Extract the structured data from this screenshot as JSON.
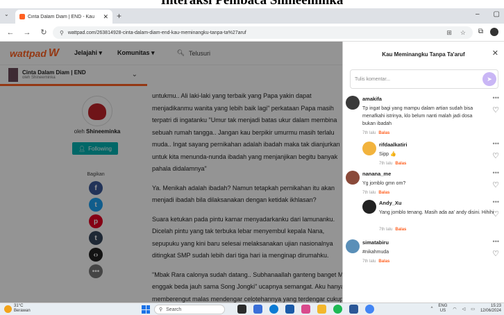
{
  "caption": "Interaksi Pembaca Shineeminka",
  "browser": {
    "tab_title": "Cinta Dalam Diam | END - Kau",
    "url": "wattpad.com/263814928-cinta-dalam-diam-end-kau-meminangku-tanpa-ta%27aruf"
  },
  "wattpad": {
    "logo": "wattpad",
    "nav": [
      "Jelajahi ▾",
      "Komunitas ▾"
    ],
    "search": "Telusuri",
    "story_title": "Cinta Dalam Diam | END",
    "story_author": "oleh Shineeminka",
    "byline_prefix": "oleh",
    "author_name": "Shineeminka",
    "follow_label": "Following",
    "share_label": "Bagikan",
    "paragraphs": [
      [
        "untukmu.. Ali laki-laki yang terbaik yang Papa yakin dapat",
        "menjadikanmu wanita yang lebih baik lagi\" perkataan Papa masih",
        "terpatri di ingatanku \"Umur tak menjadi batas ukur dalam membina",
        "sebuah rumah tangga.. Jangan kau berpikir umurmu masih terlalu",
        "muda.. Ingat sayang pernikahan adalah ibadah maka tak dianjurkan",
        "untuk kita menunda-nunda ibadah yang menjanjikan begitu banyak",
        "pahala didalamnya\""
      ],
      [
        "Ya. Menikah adalah ibadah? Namun tetapkah pernikahan itu akan",
        "menjadi ibadah bila dilaksanakan dengan ketidak ikhlasan?"
      ],
      [
        "Suara ketukan pada pintu kamar menyadarkanku dari lamunanku.",
        "Dicelah pintu yang tak terbuka lebar menyembul kepala Nana,",
        "sepupuku yang kini baru selesai melaksanakan ujian nasionalnya",
        "ditingkat SMP sudah lebih dari tiga hari ia menginap dirumahku."
      ],
      [
        "\"Mbak Rara calonya sudah datang.. Subhanaallah ganteng banget Mbak",
        "enggak beda jauh sama Song Jongki\" ucapnya semangat. Aku hanya",
        "memberengut malas mendengar celotehannya yang terdengar cukup"
      ]
    ]
  },
  "panel": {
    "title": "Kau Meminangku Tanpa Ta'aruf",
    "input_placeholder": "Tulis komentar...",
    "comments": [
      {
        "name": "amakifa",
        "text": "Tp ingat bagi yang mampu dalam artian sudah bisa menafkahi istrinya, klo belum nanti malah jadi dosa bukan ibadah",
        "time": "7th lalu",
        "reply": "Balas",
        "avatar_color": "#3a3a3a"
      },
      {
        "name": "rifdaalkatiri",
        "text": "Sipp 👍",
        "time": "7th lalu",
        "reply": "Balas",
        "avatar_color": "#f2b33d"
      },
      {
        "name": "nanana_me",
        "text": "Yg jomblo gmn om?",
        "time": "7th lalu",
        "reply": "Balas",
        "avatar_color": "#8a4a3a"
      },
      {
        "name": "Andy_Xu",
        "text": "Yang jomblo tenang. Masih ada aa' andy disini. Hihihi",
        "time": "7th lalu",
        "reply": "Balas",
        "avatar_color": "#222222"
      },
      {
        "name": "simatabiru",
        "text": "#nikahmuda",
        "time": "7th lalu",
        "reply": "Balas",
        "avatar_color": "#5a8fb8"
      }
    ]
  },
  "taskbar": {
    "temp": "31°C",
    "weather": "Berawan",
    "search": "Search",
    "lang": "ENG",
    "region": "US",
    "time": "15:23",
    "date": "12/06/2024"
  },
  "colors": {
    "brand": "#ff6122",
    "follow": "#00b2b2",
    "send": "#c9b6f5"
  }
}
